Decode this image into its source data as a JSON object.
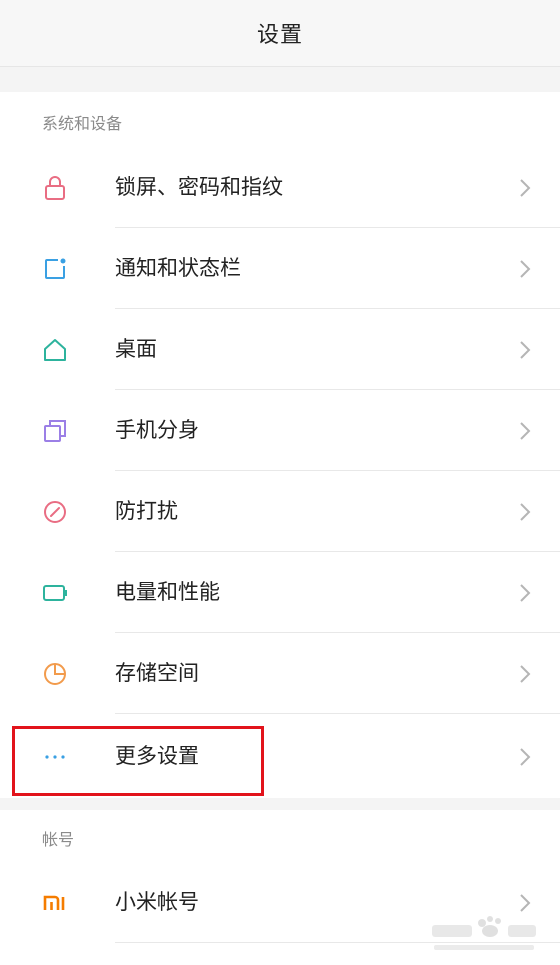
{
  "header": {
    "title": "设置"
  },
  "sections": {
    "system": {
      "title": "系统和设备",
      "items": [
        {
          "label": "锁屏、密码和指纹",
          "icon": "lock-icon",
          "color": "#e96d83"
        },
        {
          "label": "通知和状态栏",
          "icon": "notification-icon",
          "color": "#3aa0e3"
        },
        {
          "label": "桌面",
          "icon": "home-icon",
          "color": "#2db39d"
        },
        {
          "label": "手机分身",
          "icon": "clone-icon",
          "color": "#9b7fe6"
        },
        {
          "label": "防打扰",
          "icon": "do-not-disturb-icon",
          "color": "#e96d83"
        },
        {
          "label": "电量和性能",
          "icon": "battery-icon",
          "color": "#2db39d"
        },
        {
          "label": "存储空间",
          "icon": "storage-pie-icon",
          "color": "#f29b4c"
        },
        {
          "label": "更多设置",
          "icon": "more-dots-icon",
          "color": "#3aa0e3"
        }
      ]
    },
    "account": {
      "title": "帐号",
      "items": [
        {
          "label": "小米帐号",
          "icon": "mi-logo-icon",
          "color": "#f57c00"
        }
      ]
    }
  },
  "colors": {
    "highlight_box": "#e2131b",
    "chevron": "#b5b5b5"
  }
}
